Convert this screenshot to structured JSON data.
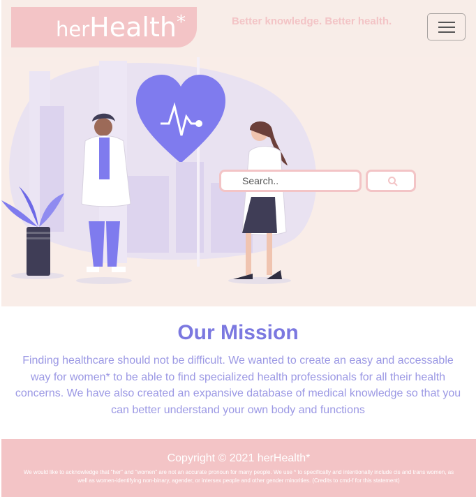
{
  "header": {
    "logo": {
      "her": "her",
      "health": "Health",
      "star": "*"
    },
    "tagline": "Better knowledge. Better health.",
    "menu_icon": "hamburger-icon"
  },
  "hero": {
    "search": {
      "placeholder": "Search..",
      "value": "Search..",
      "button_icon": "search-icon"
    },
    "illustration": "doctors-heartbeat-illustration"
  },
  "mission": {
    "title": "Our Mission",
    "body": "Finding healthcare should not be difficult. We wanted to create an easy and accessable way for women* to be able to find specialized health professionals for all their health concerns. We have also created an expansive database of medical knowledge so that you can better understand your own body and functions"
  },
  "footer": {
    "copyright": "Copyright © 2021 herHealth*",
    "acknowledgement": "We would like to acknowledge that \"her\" and \"women\" are not an accurate pronoun for many people. We use * to specifically and intentionally include cis and trans women, as well as women-identifying non-binary, agender, or intersex people and other gender minorities. (Credits to cmd-f for this statement)"
  },
  "colors": {
    "brand_pink": "#f3c4c6",
    "accent_purple": "#7b78e0",
    "hero_bg": "#f9ede8"
  }
}
